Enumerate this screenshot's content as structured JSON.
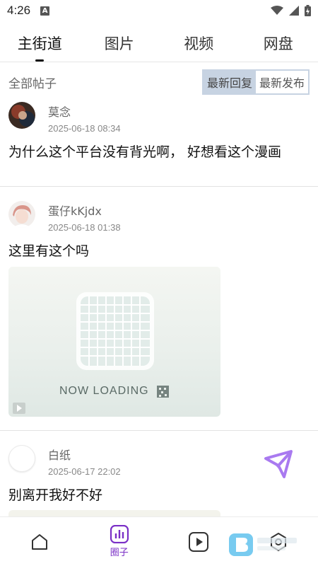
{
  "status_bar": {
    "time": "4:26",
    "notification_icon": "A",
    "icons": [
      "wifi-icon",
      "signal-icon",
      "battery-icon"
    ]
  },
  "tabs": [
    {
      "label": "主街道",
      "active": true
    },
    {
      "label": "图片",
      "active": false
    },
    {
      "label": "视频",
      "active": false
    },
    {
      "label": "网盘",
      "active": false
    }
  ],
  "filter": {
    "title": "全部帖子",
    "sort_latest_reply": "最新回复",
    "sort_latest_post": "最新发布",
    "selected": "最新回复"
  },
  "posts": [
    {
      "author": "莫念",
      "time": "2025-06-18 08:34",
      "text": "为什么这个平台没有背光啊， 好想看这个漫画"
    },
    {
      "author": "蛋仔kKjdx",
      "time": "2025-06-18 01:38",
      "text": "这里有这个吗",
      "image_caption": "NOW LOADING"
    },
    {
      "author": "白纸",
      "time": "2025-06-17 22:02",
      "text": "别离开我好不好"
    }
  ],
  "bottom_nav": {
    "items": [
      {
        "icon": "home-icon",
        "label": ""
      },
      {
        "icon": "chart-icon",
        "label": "圈子",
        "active": true
      },
      {
        "icon": "play-icon",
        "label": ""
      },
      {
        "icon": "settings-icon",
        "label": ""
      }
    ]
  },
  "colors": {
    "accent": "#7a2fc6",
    "fab": "#a97af0",
    "sort_active_bg": "#c7d3e2"
  }
}
